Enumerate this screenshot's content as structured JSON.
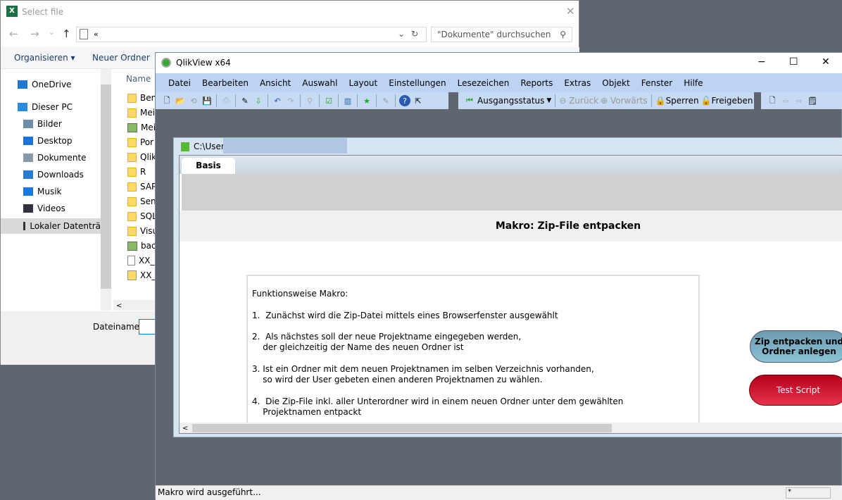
{
  "file_dialog": {
    "title": "Select file",
    "address_prefix": "«",
    "search_placeholder": "\"Dokumente\" durchsuchen",
    "organize": "Organisieren ▾",
    "new_folder": "Neuer Ordner",
    "column_name": "Name",
    "sidebar": [
      {
        "label": "OneDrive",
        "icon": "cloud-icon",
        "color": "#1e78d4"
      },
      {
        "label": "Dieser PC",
        "icon": "computer-icon",
        "color": "#2b8be0"
      },
      {
        "label": "Bilder",
        "icon": "pictures-icon",
        "color": "#6a8fa8"
      },
      {
        "label": "Desktop",
        "icon": "desktop-icon",
        "color": "#1a73d9"
      },
      {
        "label": "Dokumente",
        "icon": "document-icon",
        "color": "#8899aa"
      },
      {
        "label": "Downloads",
        "icon": "download-icon",
        "color": "#2a7ad5"
      },
      {
        "label": "Musik",
        "icon": "music-icon",
        "color": "#1a7ae0"
      },
      {
        "label": "Videos",
        "icon": "video-icon",
        "color": "#334"
      },
      {
        "label": "Lokaler Datenträ",
        "icon": "drive-icon",
        "color": "#333"
      }
    ],
    "files": [
      {
        "name": "Ben",
        "type": "folder"
      },
      {
        "name": "Mei",
        "type": "folder"
      },
      {
        "name": "Mei",
        "type": "special"
      },
      {
        "name": "Por",
        "type": "folder"
      },
      {
        "name": "Qlik",
        "type": "folder"
      },
      {
        "name": "R",
        "type": "folder"
      },
      {
        "name": "SAP",
        "type": "folder"
      },
      {
        "name": "Sen",
        "type": "folder"
      },
      {
        "name": "SQL",
        "type": "folder"
      },
      {
        "name": "Visu",
        "type": "folder"
      },
      {
        "name": "bac",
        "type": "shortcut"
      },
      {
        "name": "XX_",
        "type": "file"
      },
      {
        "name": "XX_",
        "type": "zip"
      }
    ],
    "filename_label": "Dateiname:",
    "filename_value": ""
  },
  "qlikview": {
    "title": "QlikView x64",
    "window_controls": [
      "−",
      "☐",
      "✕"
    ],
    "menu": [
      "Datei",
      "Bearbeiten",
      "Ansicht",
      "Auswahl",
      "Layout",
      "Einstellungen",
      "Lesezeichen",
      "Reports",
      "Extras",
      "Objekt",
      "Fenster",
      "Hilfe"
    ],
    "toolbar2": {
      "state": "Ausgangsstatus",
      "back": "Zurück",
      "forward": "Vorwärts",
      "lock": "Sperren",
      "unlock": "Freigeben"
    },
    "document": {
      "path": "C:\\Users",
      "tab": "Basis",
      "heading": "Makro: Zip-File entpacken",
      "text": "Funktionsweise Makro:\n\n1.  Zunächst wird die Zip-Datei mittels eines Browserfenster ausgewählt\n\n2.  Als nächstes soll der neue Projektname eingegeben werden,\n    der gleichzeitig der Name des neuen Ordner ist\n\n3. Ist ein Ordner mit dem neuen Projektnamen im selben Verzeichnis vorhanden,\n    so wird der User gebeten einen anderen Projektnamen zu wählen.\n\n4.  Die Zip-File inkl. aller Unterordner wird in einem neuen Ordner unter dem gewählten\n    Projektnamen entpackt",
      "button_zip": "Zip entpacken und Ordner anlegen",
      "button_test": "Test Script"
    },
    "status": "Makro wird ausgeführt...",
    "status_indicator": "*"
  }
}
